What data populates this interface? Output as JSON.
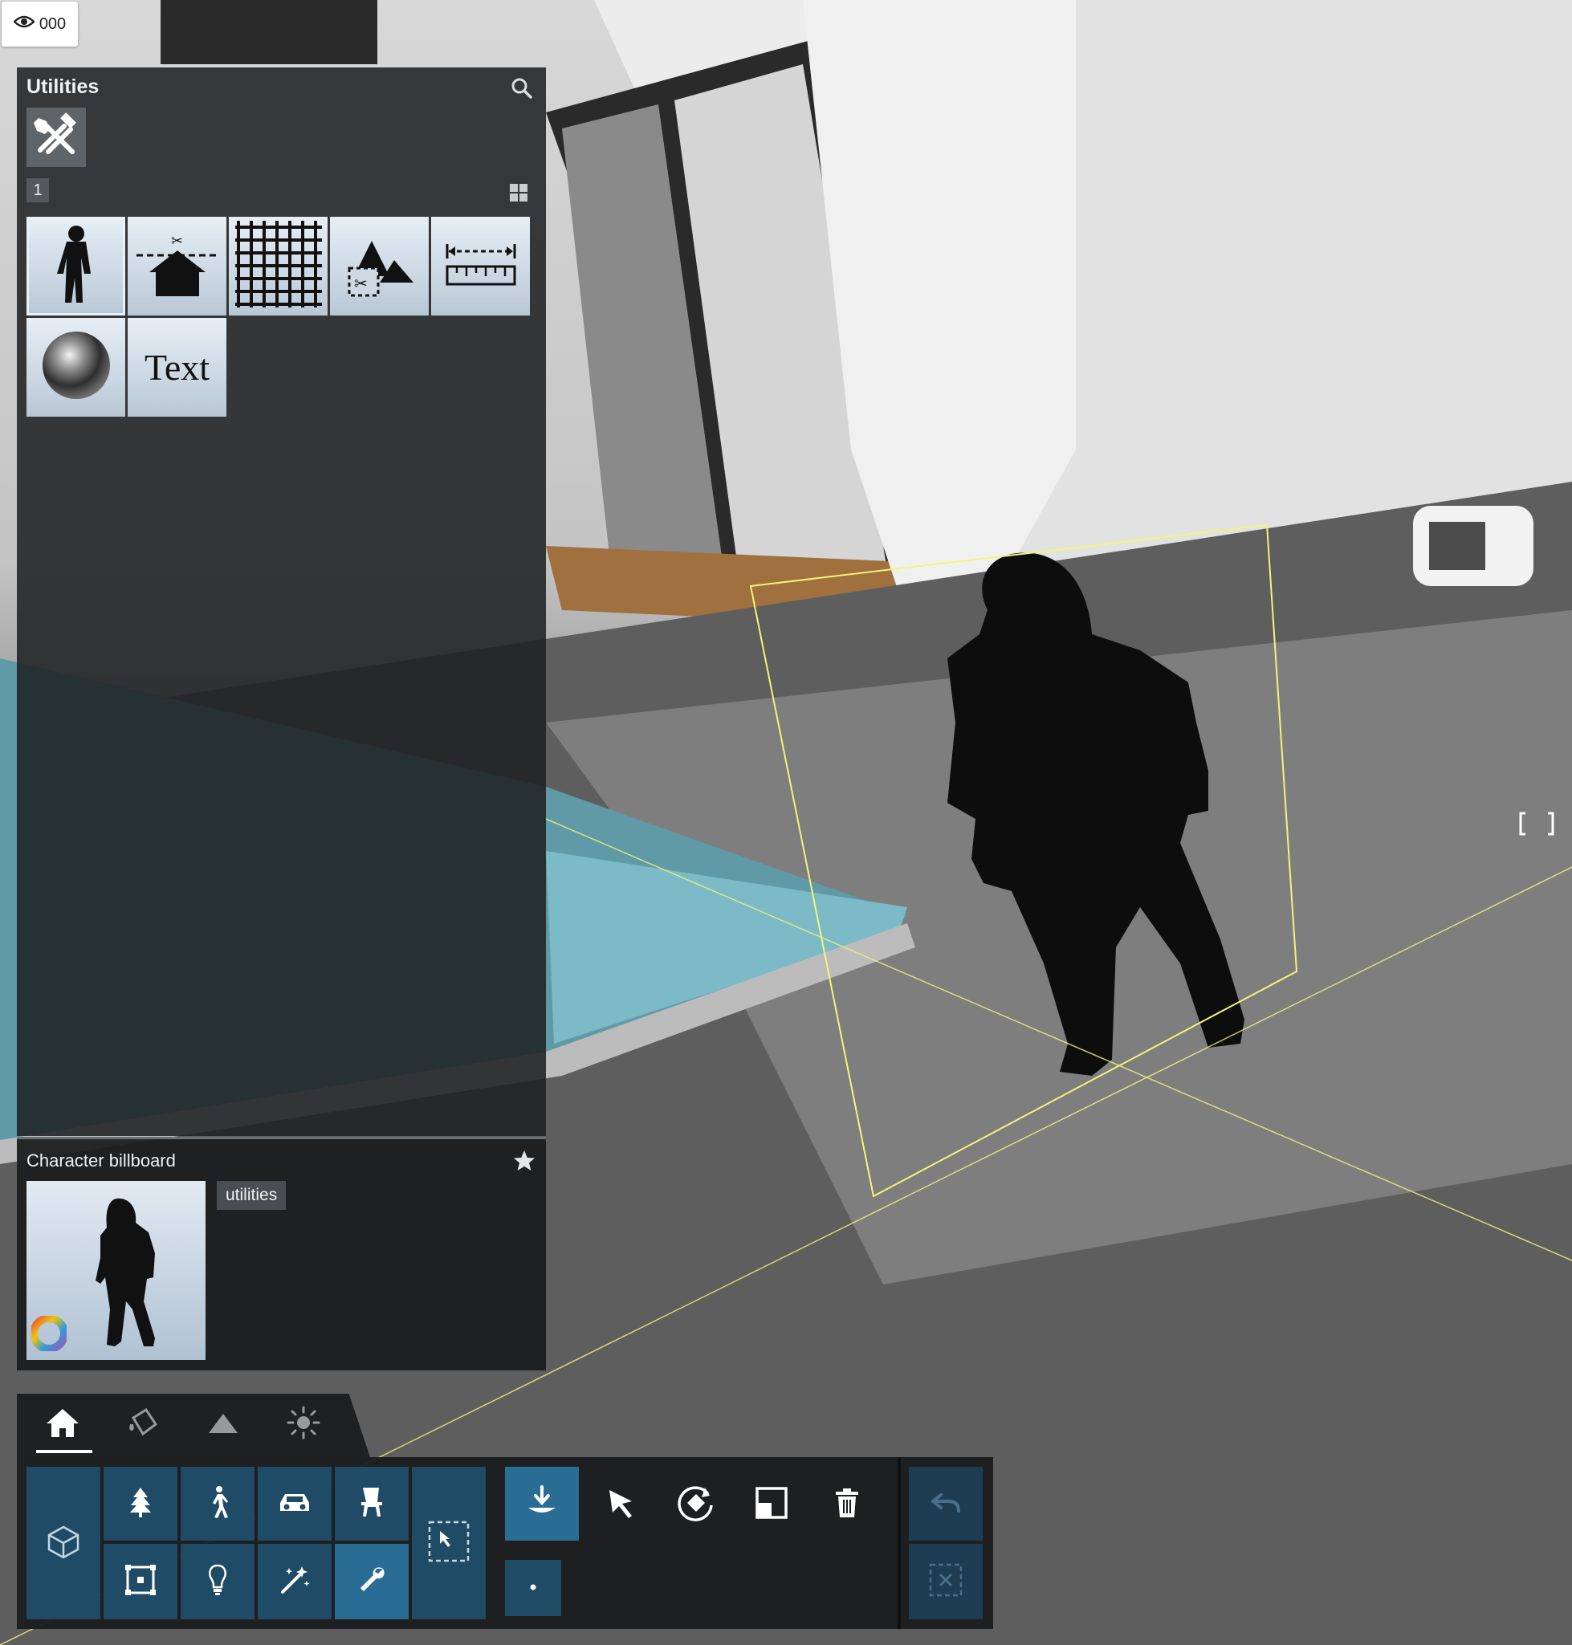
{
  "viewer": {
    "count": "000",
    "icon": "eye-icon"
  },
  "utilities_panel": {
    "title": "Utilities",
    "search_icon": "search-icon",
    "category_icon": "hammer-wrench-icon",
    "page_number": "1",
    "view_toggle_icon": "grid-view-icon",
    "items": [
      {
        "name": "character-billboard",
        "icon": "person-silhouette-icon",
        "selected": true
      },
      {
        "name": "cut-house",
        "icon": "house-cut-icon"
      },
      {
        "name": "grid",
        "icon": "grid-icon"
      },
      {
        "name": "terrain-cut",
        "icon": "mountain-cut-icon"
      },
      {
        "name": "measure",
        "icon": "ruler-icon"
      },
      {
        "name": "reflection-sphere",
        "icon": "chrome-sphere-icon"
      },
      {
        "name": "text",
        "label": "Text"
      }
    ]
  },
  "detail": {
    "title": "Character billboard",
    "favorite_icon": "star-icon",
    "tag": "utilities",
    "color_icon": "color-wheel-icon"
  },
  "bottom_tabs": [
    {
      "name": "home",
      "icon": "home-icon",
      "active": true
    },
    {
      "name": "materials",
      "icon": "paint-bucket-icon"
    },
    {
      "name": "landscape",
      "icon": "mountain-icon"
    },
    {
      "name": "sun",
      "icon": "sun-icon"
    }
  ],
  "toolbar": {
    "library_buttons": [
      {
        "name": "models",
        "icon": "cube-icon"
      },
      {
        "name": "vegetation",
        "icon": "tree-icon"
      },
      {
        "name": "people",
        "icon": "walking-person-icon"
      },
      {
        "name": "vehicles",
        "icon": "car-icon"
      },
      {
        "name": "furniture",
        "icon": "chair-icon"
      },
      {
        "name": "objects",
        "icon": "object-frame-icon"
      },
      {
        "name": "lights",
        "icon": "lightbulb-icon"
      },
      {
        "name": "effects",
        "icon": "magic-wand-icon"
      },
      {
        "name": "utilities",
        "icon": "wrench-icon",
        "active": true
      },
      {
        "name": "select-area",
        "icon": "selection-rectangle-icon"
      }
    ],
    "tools": [
      {
        "name": "place",
        "icon": "place-down-icon",
        "active": true
      },
      {
        "name": "select",
        "icon": "cursor-icon"
      },
      {
        "name": "rotate",
        "icon": "rotate-icon"
      },
      {
        "name": "scale",
        "icon": "scale-icon"
      },
      {
        "name": "delete",
        "icon": "trash-icon"
      },
      {
        "name": "point",
        "icon": "dot-icon"
      }
    ],
    "history": [
      {
        "name": "undo",
        "icon": "undo-icon"
      },
      {
        "name": "deselect",
        "icon": "deselect-icon"
      }
    ]
  },
  "colors": {
    "panel_bg": "#202123",
    "button_blue": "#1f4b66",
    "button_active": "#2a6d94",
    "selection_outline": "#f4f47a"
  }
}
